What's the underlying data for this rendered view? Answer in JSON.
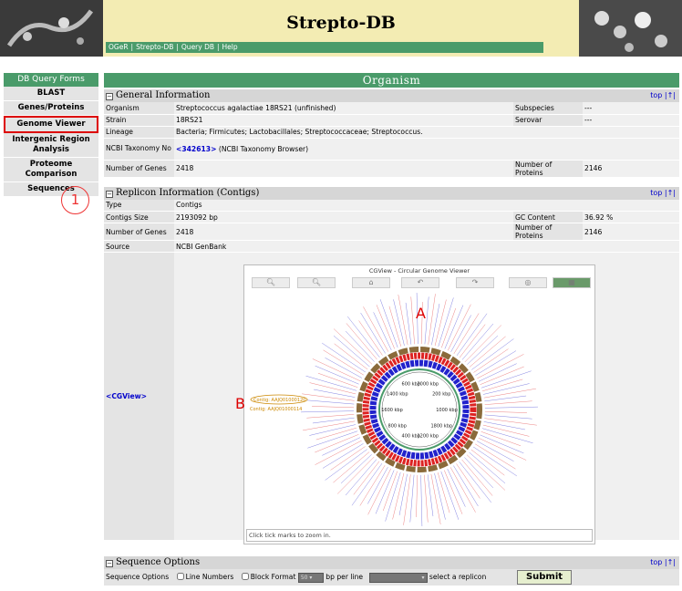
{
  "header": {
    "title": "Strepto-DB",
    "nav": [
      "OGeR",
      "Strepto-DB",
      "Query DB",
      "Help"
    ]
  },
  "sidebar": {
    "title": "DB Query Forms",
    "items": [
      {
        "label": "BLAST"
      },
      {
        "label": "Genes/Proteins"
      },
      {
        "label": "Genome Viewer",
        "active": true
      },
      {
        "label": "Intergenic Region Analysis"
      },
      {
        "label": "Proteome Comparison"
      },
      {
        "label": "Sequences"
      }
    ]
  },
  "page_title": "Organism",
  "general": {
    "title": "General Information",
    "top": "top",
    "top_icon": "↑",
    "organism_label": "Organism",
    "organism": "Streptococcus agalactiae 18RS21 (unfinished)",
    "subspecies_label": "Subspecies",
    "subspecies": "---",
    "strain_label": "Strain",
    "strain": "18RS21",
    "serovar_label": "Serovar",
    "serovar": "---",
    "lineage_label": "Lineage",
    "lineage": "Bacteria; Firmicutes; Lactobacillales; Streptococcaceae; Streptococcus.",
    "taxonomy_label": "NCBI Taxonomy No",
    "taxonomy_link": "<342613>",
    "taxonomy_suffix": "(NCBI Taxonomy Browser)",
    "genes_label": "Number of Genes",
    "genes": "2418",
    "proteins_label": "Number of Proteins",
    "proteins": "2146"
  },
  "replicon": {
    "title": "Replicon Information (Contigs)",
    "top": "top",
    "top_icon": "↑",
    "type_label": "Type",
    "type": "Contigs",
    "size_label": "Contigs Size",
    "size": "2193092 bp",
    "gc_label": "GC Content",
    "gc": "36.92 %",
    "genes_label": "Number of Genes",
    "genes": "2418",
    "proteins_label": "Number of Proteins",
    "proteins": "2146",
    "source_label": "Source",
    "source": "NCBI GenBank",
    "cgview_label": "<CGView>"
  },
  "cgview": {
    "window_title": "CGView - Circular Genome Viewer",
    "footer": "Click tick marks to zoom in.",
    "ticks": [
      "2000 kbp",
      "200 kbp",
      "1800 kbp",
      "400 kbp",
      "1600 kbp",
      "600 kbp",
      "1400 kbp",
      "800 kbp",
      "1200 kbp",
      "1000 kbp"
    ],
    "highlight": "Contig: AAJQ01000120",
    "highlight2": "Contig: AAJQ01000114",
    "colors": {
      "forward": "#2222cc",
      "reverse": "#dd2222",
      "contig": "#8a6a3a",
      "accent": "#4a9b6a"
    }
  },
  "annotations": {
    "circle": "1",
    "a": "A",
    "b": "B"
  },
  "seq_options": {
    "title": "Sequence Options",
    "top": "top",
    "top_icon": "↑",
    "label": "Sequence Options",
    "line_numbers": "Line Numbers",
    "block_format": "Block Format",
    "bp_value": "50",
    "bp_label": "bp per line",
    "replicon_label": "select a replicon",
    "submit": "Submit"
  }
}
